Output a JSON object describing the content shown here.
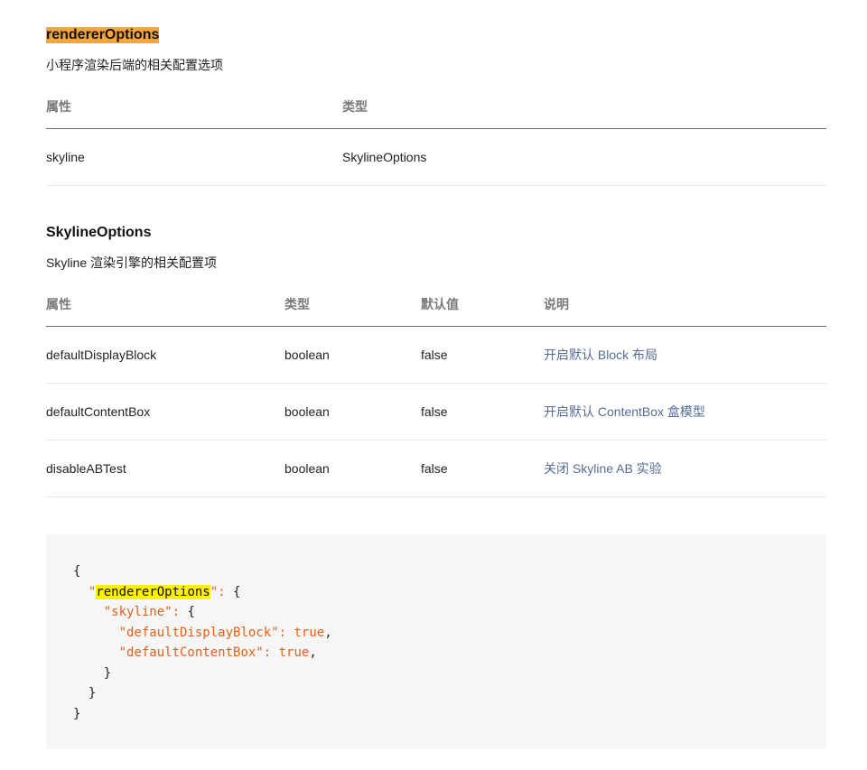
{
  "section1": {
    "title": "rendererOptions",
    "description": "小程序渲染后端的相关配置选项",
    "headers": [
      "属性",
      "类型"
    ],
    "rows": [
      {
        "name": "skyline",
        "type": "SkylineOptions"
      }
    ]
  },
  "section2": {
    "title": "SkylineOptions",
    "description": "Skyline 渲染引擎的相关配置项",
    "headers": [
      "属性",
      "类型",
      "默认值",
      "说明"
    ],
    "rows": [
      {
        "name": "defaultDisplayBlock",
        "type": "boolean",
        "default": "false",
        "note": "开启默认 Block 布局"
      },
      {
        "name": "defaultContentBox",
        "type": "boolean",
        "default": "false",
        "note": "开启默认 ContentBox 盒模型"
      },
      {
        "name": "disableABTest",
        "type": "boolean",
        "default": "false",
        "note": "关闭 Skyline AB 实验"
      }
    ]
  },
  "code": {
    "open_brace": "{",
    "renderer_key": "rendererOptions",
    "skyline_key": "\"skyline\"",
    "display_block_key": "\"defaultDisplayBlock\"",
    "content_box_key": "\"defaultContentBox\"",
    "true_value": "true",
    "close_brace": "}"
  },
  "colors": {
    "title_highlight": "#f5a53a",
    "code_highlight": "#fff200",
    "link": "#576b95",
    "code_string": "#e2621c",
    "code_background": "#f6f6f6"
  }
}
